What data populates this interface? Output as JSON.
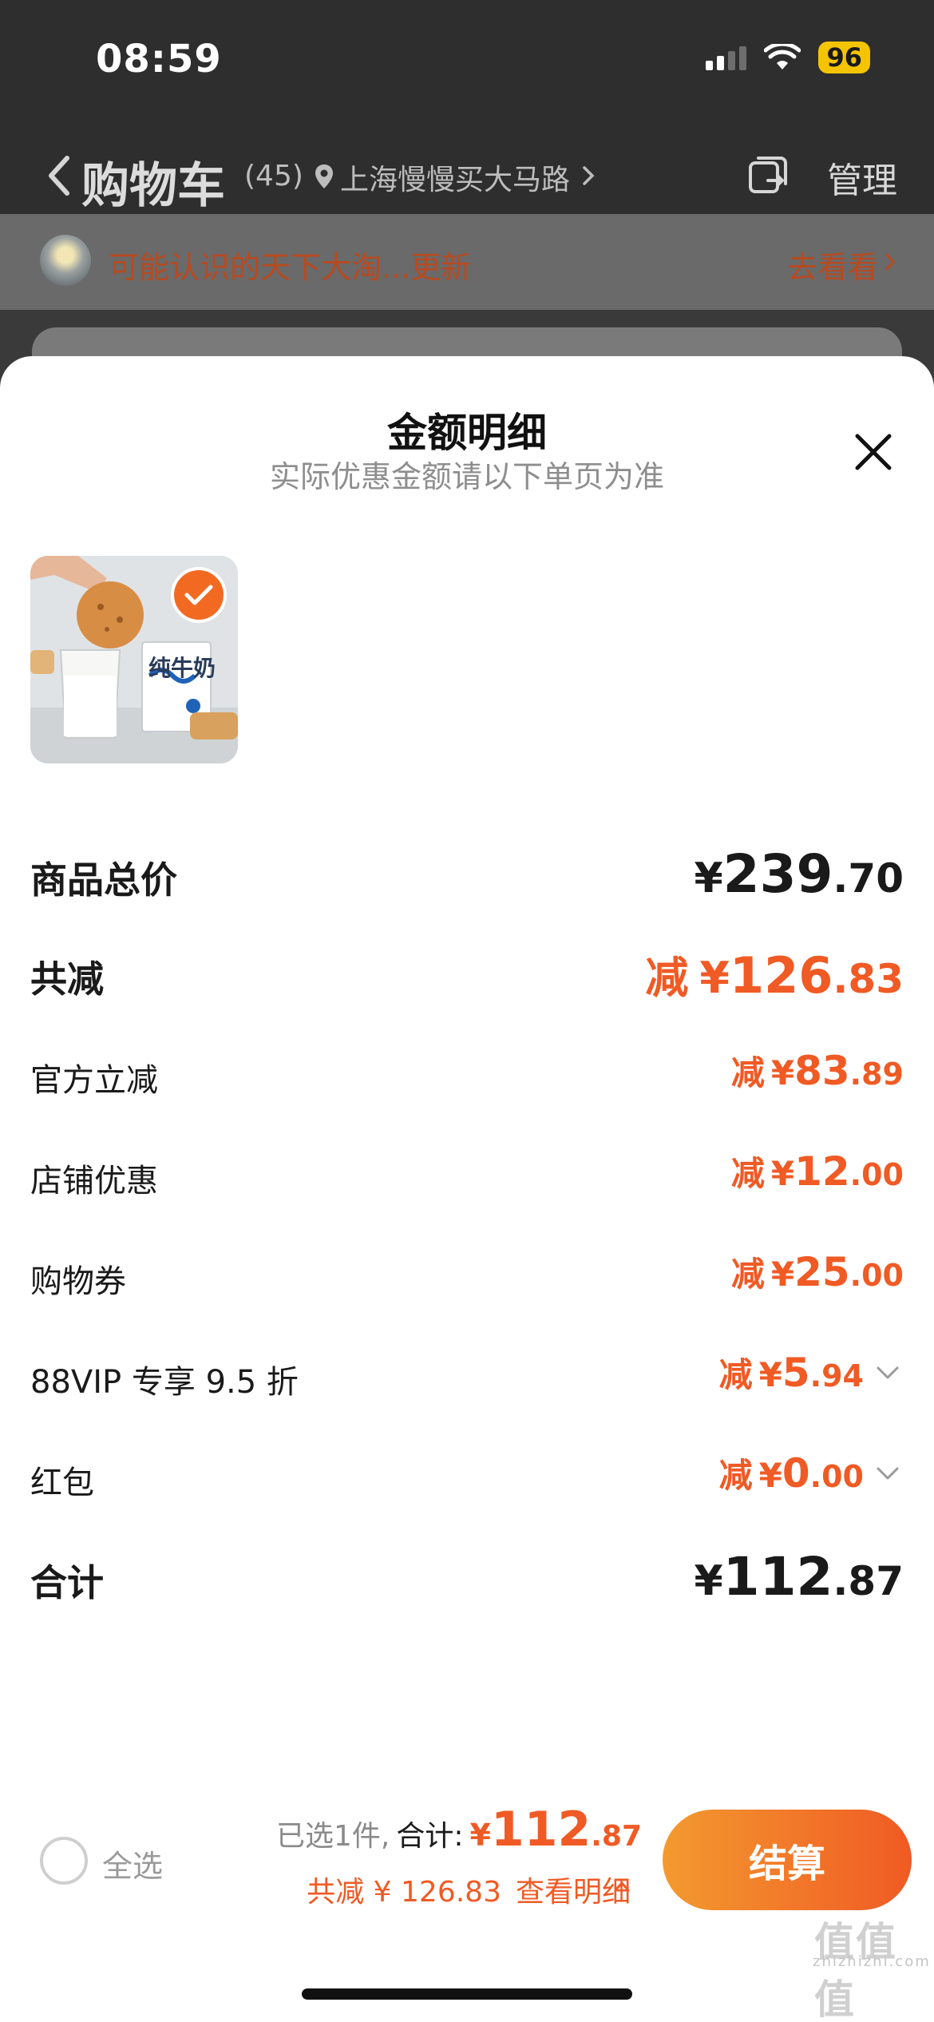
{
  "status_bar": {
    "time": "08:59",
    "battery": "96"
  },
  "nav": {
    "title": "购物车",
    "count": "(45)",
    "location": "上海慢慢买大马路",
    "manage": "管理"
  },
  "banner": {
    "text": "可能认识的天下大淘...更新",
    "link": "去看看"
  },
  "sheet": {
    "title": "金额明细",
    "subtitle": "实际优惠金额请以下单页为准",
    "product_image_text": "纯牛奶"
  },
  "rows": [
    {
      "label": "商品总价",
      "prefix": "",
      "yen": "¥",
      "int": "239",
      "dec": ".70"
    },
    {
      "label": "共减",
      "prefix": "减",
      "yen": "¥",
      "int": "126",
      "dec": ".83"
    },
    {
      "label": "官方立减",
      "prefix": "减",
      "yen": "¥",
      "int": "83",
      "dec": ".89"
    },
    {
      "label": "店铺优惠",
      "prefix": "减",
      "yen": "¥",
      "int": "12",
      "dec": ".00"
    },
    {
      "label": "购物券",
      "prefix": "减",
      "yen": "¥",
      "int": "25",
      "dec": ".00"
    },
    {
      "label": "88VIP 专享 9.5 折",
      "prefix": "减",
      "yen": "¥",
      "int": "5",
      "dec": ".94"
    },
    {
      "label": "红包",
      "prefix": "减",
      "yen": "¥",
      "int": "0",
      "dec": ".00"
    },
    {
      "label": "合计",
      "prefix": "",
      "yen": "¥",
      "int": "112",
      "dec": ".87"
    }
  ],
  "bottom": {
    "select_all": "全选",
    "selected": "已选1件,",
    "total_label": "合计:",
    "total_yen": "¥",
    "total_int": "112",
    "total_dec": ".87",
    "saved": "共减 ¥ 126.83",
    "detail": "查看明细",
    "checkout": "结算"
  },
  "watermark": {
    "logo": "值值值",
    "text": "zhizhizhi.com"
  },
  "colors": {
    "accent": "#f05a24",
    "accent_light": "#f39a2f",
    "dark": "#1a1a1a"
  }
}
